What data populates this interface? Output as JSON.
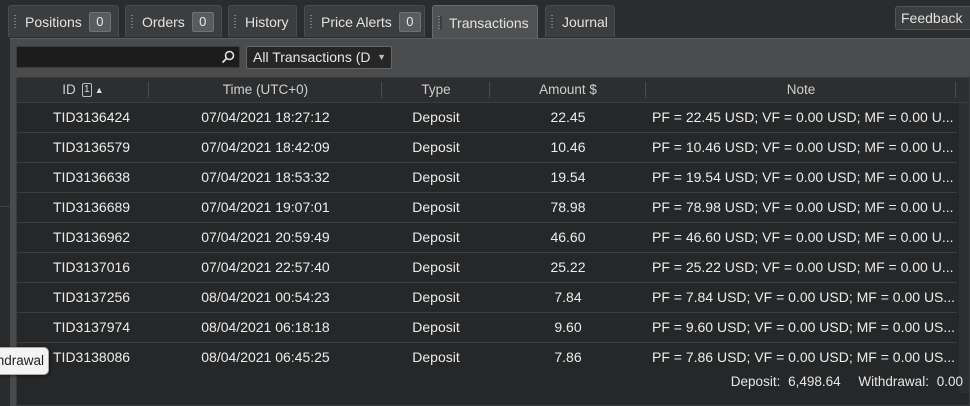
{
  "tabs": [
    {
      "label": "Positions",
      "badge": "0"
    },
    {
      "label": "Orders",
      "badge": "0"
    },
    {
      "label": "History"
    },
    {
      "label": "Price Alerts",
      "badge": "0"
    },
    {
      "label": "Transactions",
      "active": true
    },
    {
      "label": "Journal"
    }
  ],
  "feedback_label": "Feedback",
  "search": {
    "placeholder": "",
    "icon": "search-icon"
  },
  "filter": {
    "selected": "All Transactions (D"
  },
  "columns": {
    "id": "ID",
    "sort_index": "1",
    "time": "Time (UTC+0)",
    "type": "Type",
    "amount": "Amount $",
    "note": "Note"
  },
  "rows": [
    {
      "id": "TID3136424",
      "time": "07/04/2021 18:27:12",
      "type": "Deposit",
      "amount": "22.45",
      "note": "PF = 22.45 USD; VF = 0.00 USD; MF = 0.00 U..."
    },
    {
      "id": "TID3136579",
      "time": "07/04/2021 18:42:09",
      "type": "Deposit",
      "amount": "10.46",
      "note": "PF = 10.46 USD; VF = 0.00 USD; MF = 0.00 U..."
    },
    {
      "id": "TID3136638",
      "time": "07/04/2021 18:53:32",
      "type": "Deposit",
      "amount": "19.54",
      "note": "PF = 19.54 USD; VF = 0.00 USD; MF = 0.00 U..."
    },
    {
      "id": "TID3136689",
      "time": "07/04/2021 19:07:01",
      "type": "Deposit",
      "amount": "78.98",
      "note": "PF = 78.98 USD; VF = 0.00 USD; MF = 0.00 U..."
    },
    {
      "id": "TID3136962",
      "time": "07/04/2021 20:59:49",
      "type": "Deposit",
      "amount": "46.60",
      "note": "PF = 46.60 USD; VF = 0.00 USD; MF = 0.00 U..."
    },
    {
      "id": "TID3137016",
      "time": "07/04/2021 22:57:40",
      "type": "Deposit",
      "amount": "25.22",
      "note": "PF = 25.22 USD; VF = 0.00 USD; MF = 0.00 U..."
    },
    {
      "id": "TID3137256",
      "time": "08/04/2021 00:54:23",
      "type": "Deposit",
      "amount": "7.84",
      "note": "PF = 7.84 USD; VF = 0.00 USD; MF = 0.00 US..."
    },
    {
      "id": "TID3137974",
      "time": "08/04/2021 06:18:18",
      "type": "Deposit",
      "amount": "9.60",
      "note": "PF = 9.60 USD; VF = 0.00 USD; MF = 0.00 US..."
    },
    {
      "id": "TID3138086",
      "time": "08/04/2021 06:45:25",
      "type": "Deposit",
      "amount": "7.86",
      "note": "PF = 7.86 USD; VF = 0.00 USD; MF = 0.00 US..."
    }
  ],
  "totals": {
    "deposit_label": "Deposit:",
    "deposit_value": "6,498.64",
    "withdrawal_label": "Withdrawal:",
    "withdrawal_value": "0.00"
  },
  "tooltip": "ndrawal"
}
